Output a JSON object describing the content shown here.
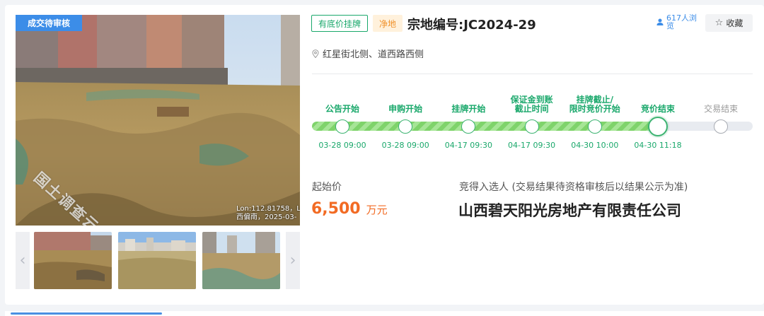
{
  "status_tag": "成交待审核",
  "photo": {
    "watermark": "国土调查云",
    "geo_line1": "Lon:112.81758，L",
    "geo_line2": "西偏南，2025-03-"
  },
  "thumbnails": {
    "prev_label": "‹",
    "next_label": "›"
  },
  "tags": {
    "listing_type": "有底价挂牌",
    "land_type": "净地"
  },
  "parcel_title": "宗地编号:JC2024-29",
  "views_text": "617人浏览",
  "favorite_label": "收藏",
  "address": "红星街北侧、道西路西侧",
  "timeline": {
    "steps": [
      {
        "label": "公告开始",
        "date": "03-28 09:00"
      },
      {
        "label": "申购开始",
        "date": "03-28 09:00"
      },
      {
        "label": "挂牌开始",
        "date": "04-17 09:30"
      },
      {
        "label": "保证金到账截止时间",
        "date": "04-17 09:30"
      },
      {
        "label": "挂牌截止/限时竞价开始",
        "date": "04-30 10:00"
      },
      {
        "label": "竞价结束",
        "date": "04-30 11:18"
      },
      {
        "label": "交易结束",
        "date": ""
      }
    ],
    "current_step": 6,
    "accent_color": "#1aa86b"
  },
  "price": {
    "label": "起始价",
    "value": "6,500",
    "unit": "万元",
    "color": "#f26b24"
  },
  "winner": {
    "label": "竞得入选人 (交易结果待资格审核后以结果公示为准)",
    "name": "山西碧天阳光房地产有限责任公司"
  }
}
